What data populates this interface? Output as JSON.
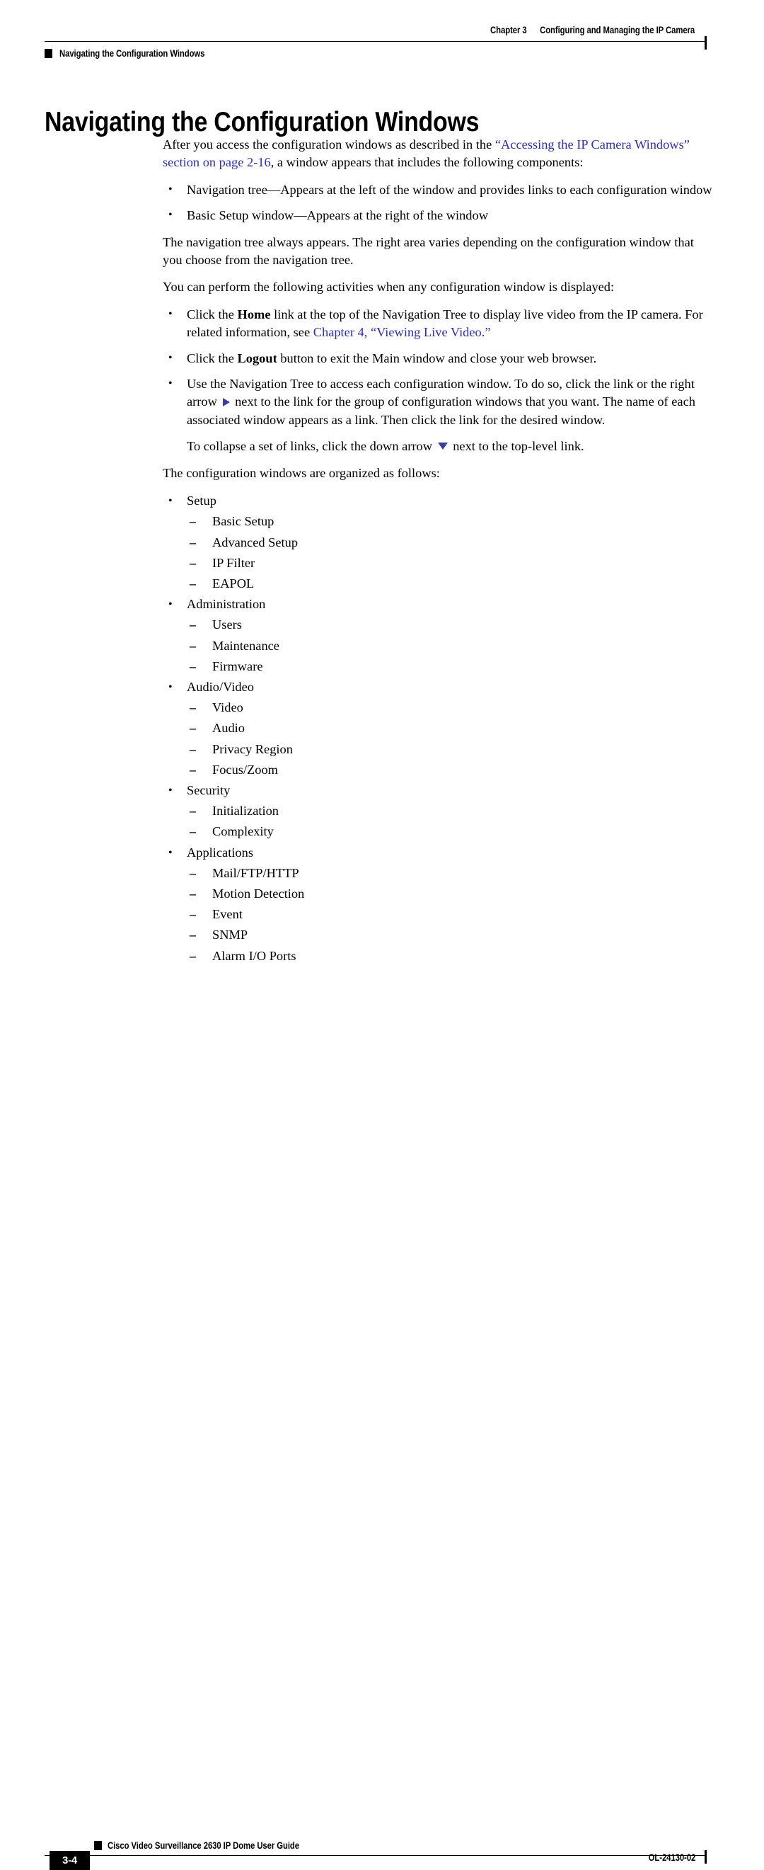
{
  "header": {
    "chapter_number": "Chapter 3",
    "chapter_title": "Configuring and Managing the IP Camera",
    "section_title": "Navigating the Configuration Windows"
  },
  "page_title": "Navigating the Configuration Windows",
  "intro": {
    "p1_before_link": "After you access the configuration windows as described in the ",
    "p1_link": "“Accessing the IP Camera Windows” section on page 2-16",
    "p1_after_link": ", a window appears that includes the following components:",
    "components": [
      "Navigation tree—Appears at the left of the window and provides links to each configuration window",
      "Basic Setup window—Appears at the right of the window"
    ],
    "p2": "The navigation tree always appears. The right area varies depending on the configuration window that you choose from the navigation tree.",
    "p3": "You can perform the following activities when any configuration window is displayed:"
  },
  "activities": {
    "home_pre": "Click the ",
    "home_bold": "Home",
    "home_mid": " link at the top of the Navigation Tree to display live video from the IP camera. For related information, see ",
    "home_link": "Chapter 4, “Viewing Live Video.”",
    "logout_pre": "Click the ",
    "logout_bold": "Logout",
    "logout_post": " button to exit the Main window and close your web browser.",
    "navtree_part1": "Use the Navigation Tree to access each configuration window. To do so, click the link or the right arrow ",
    "navtree_arrow_right": "right-arrow-icon",
    "navtree_part2": " next to the link for the group of configuration windows that you want. The name of each associated window appears as a link. Then click the link for the desired window.",
    "collapse_part1": "To collapse a set of links, click the down arrow ",
    "collapse_arrow_down": "down-arrow-icon",
    "collapse_part2": " next to the top-level link."
  },
  "organized_intro": "The configuration windows are organized as follows:",
  "tree": [
    {
      "label": "Setup",
      "children": [
        "Basic Setup",
        "Advanced Setup",
        "IP Filter",
        "EAPOL"
      ]
    },
    {
      "label": "Administration",
      "children": [
        "Users",
        "Maintenance",
        "Firmware"
      ]
    },
    {
      "label": "Audio/Video",
      "children": [
        "Video",
        "Audio",
        "Privacy Region",
        "Focus/Zoom"
      ]
    },
    {
      "label": "Security",
      "children": [
        "Initialization",
        "Complexity"
      ]
    },
    {
      "label": "Applications",
      "children": [
        "Mail/FTP/HTTP",
        "Motion Detection",
        "Event",
        "SNMP",
        "Alarm I/O Ports"
      ]
    }
  ],
  "footer": {
    "page_number": "3-4",
    "guide_title": "Cisco Video Surveillance 2630 IP Dome User Guide",
    "doc_id": "OL-24130-02"
  },
  "colors": {
    "link": "#2b2bc8",
    "arrow": "#3a3ab4",
    "rule": "#000000"
  }
}
